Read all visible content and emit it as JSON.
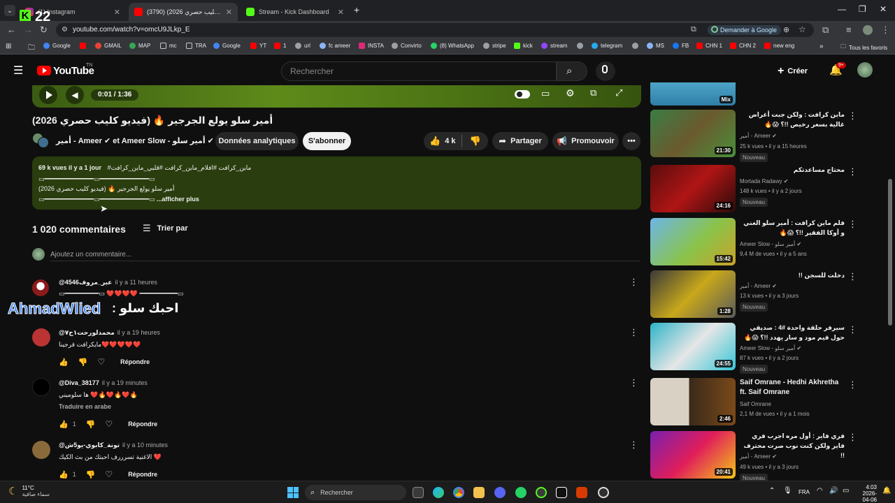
{
  "browser": {
    "tabs": [
      {
        "label": "(1) Instagram"
      },
      {
        "label": "(3790) أمير سلو يولع الجرجير 🔥 (فيديو كليب حصري 2026) - YouTube"
      },
      {
        "label": "Stream - Kick Dashboard"
      }
    ],
    "overlay_counter": "22",
    "url": "youtube.com/watch?v=omcU9JLkp_E",
    "translate_label": "Demander à Google",
    "bookmarks": [
      "Google",
      "GMAIL",
      "MAP",
      "mc",
      "TRA",
      "Google",
      "YT",
      "1",
      "url",
      "fc ameer",
      "INSTA",
      "Convirto",
      "(8) WhatsApp",
      "stripe",
      "kick",
      "stream",
      "telegram",
      "MS",
      "FB",
      "CHN 1",
      "CHN 2",
      "new eng"
    ],
    "all_bookmarks_label": "Tous les favoris"
  },
  "youtube": {
    "logo_text": "YouTube",
    "logo_region": "TN",
    "search_placeholder": "Rechercher",
    "create_label": "Créer",
    "notif_badge": "9+"
  },
  "player": {
    "time": "0:01 / 1:36"
  },
  "video": {
    "title": "أمير سلو يولع الجرجير 🔥 (فيديو كليب حصري 2026)",
    "channel": "أمير - Ameer ✔ et Ameer Slow - أمير سلو ✔",
    "analytics_label": "Données analytiques",
    "subscribe_label": "S'abonner",
    "likes": "4 k",
    "share_label": "Partager",
    "promote_label": "Promouvoir"
  },
  "description": {
    "views_date": "69 k vues  il y a 1 jour",
    "hashtags": "#ماين_كرافت #افلام_ماين_كرافت #قلبي_ماين_كرافت",
    "line2": "أمير سلو يولع الجرجير 🔥 (فيديو كليب حصري 2026)",
    "more_label": "...afficher plus"
  },
  "comments": {
    "count_label": "1 020 commentaires",
    "sort_label": "Trier par",
    "add_placeholder": "Ajoutez un commentaire...",
    "overlay_text_left": "AhmadWlied",
    "overlay_text_right": "احبك سلو :",
    "items": [
      {
        "author": "@4546عبر_مروف",
        "time": "il y a 11 heures",
        "text": "❤️❤️❤️❤️",
        "likes": "",
        "reply": "Répondre",
        "translate": ""
      },
      {
        "author": "@محمدلورحت١ح٧",
        "time": "il y a 19 heures",
        "text": "مايكرافت    قرجينا❤️❤️❤️❤️❤️",
        "likes": "",
        "reply": "Répondre",
        "translate": ""
      },
      {
        "author": "@Diva_38177",
        "time": "il y a 19 minutes",
        "text": "ها سلوميني ❤️🔥❤️🔥❤️🔥",
        "likes": "1",
        "reply": "Répondre",
        "translate": "Traduire en arabe"
      },
      {
        "author": "@تونة_كابوي-يو5ش",
        "time": "il y a 10 minutes",
        "text": "الاغنية تسرررف احبتك من بث الكيك ❤️",
        "likes": "1",
        "reply": "Répondre",
        "translate": ""
      }
    ]
  },
  "sidebar": {
    "top_partial_badge": "Mix",
    "videos": [
      {
        "title": "ماين كرافت : ولكن جبت أغراض غالية بسعر رخيص !!؟ 😱🔥",
        "channel": "أمير - Ameer ✔",
        "meta": "25 k vues • il y a 15 heures",
        "badge": "Nouveau",
        "duration": "21:30"
      },
      {
        "title": "محتاج مساعدتكم",
        "channel": "Mortada Radawy ✔",
        "meta": "148 k vues • il y a 2 jours",
        "badge": "Nouveau",
        "duration": "24:16"
      },
      {
        "title": "فلم ماين كرافت : أمير سلو الغني و أوكا الفقير !!؟ 😱🔥",
        "channel": "Ameer Slow - أمير سلو ✔",
        "meta": "9,4 M de vues • il y a 5 ans",
        "badge": "",
        "duration": "15:42"
      },
      {
        "title": "دخلت للسجن !!",
        "channel": "أمير - Ameer ✔",
        "meta": "13 k vues • il y a 3 jours",
        "badge": "Nouveau",
        "duration": "1:28"
      },
      {
        "title": "سيرفر حلقة واحدة #4 : صديقي حول قيم مود و سار يهدد !!؟ 😱🔥",
        "channel": "Ameer Slow - أمير سلو ✔",
        "meta": "87 k vues • il y a 2 jours",
        "badge": "Nouveau",
        "duration": "24:55"
      },
      {
        "title": "Saif Omrane - Hedhi Akhretha ft. Saif Omrane",
        "channel": "Saif Omrane",
        "meta": "2,1 M de vues • il y a 1 mois",
        "badge": "",
        "duration": "2:46"
      },
      {
        "title": "فري فاير : أول مره اجرب فري فاير ولكن كنت نوب صرت محترف !!",
        "channel": "أمير - Ameer ✔",
        "meta": "49 k vues • il y a 3 jours",
        "badge": "Nouveau",
        "duration": "20:41"
      }
    ]
  },
  "taskbar": {
    "weather_temp": "11°C",
    "weather_desc": "سماء صافية",
    "search_label": "Rechercher",
    "lang": "FRA",
    "time": "4:03",
    "date": "2026-04-06"
  },
  "colors": {
    "yt_red": "#ff0000",
    "description_bg": "#2a3d0e",
    "subscribe_bg": "#f1f1f1",
    "overlay_blue": "#3b82f6"
  }
}
